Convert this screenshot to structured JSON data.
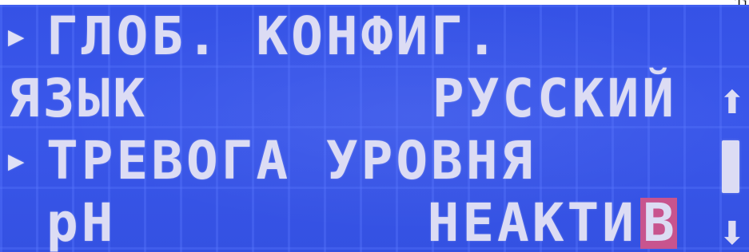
{
  "corner_text": "Ti",
  "screen": {
    "menu_title": "ГЛОБ. КОНФИГ.",
    "selection_pointer": "▶",
    "rows": [
      {
        "label": "ЯЗЫК",
        "value": "РУССКИЙ"
      },
      {
        "label": "ТРЕВОГА УРОВНЯ",
        "value": ""
      },
      {
        "label": "pH",
        "value": "НЕАКТИ",
        "cursor_char": "В"
      }
    ]
  },
  "scrollbar": {
    "up_icon": "up-arrow-icon",
    "down_icon": "down-arrow-icon",
    "up_glyph": "⬆",
    "down_glyph": "⬇"
  },
  "colors": {
    "lcd_background": "#3a57ea",
    "lcd_text": "#dcdcf4",
    "cursor_highlight": "#c8548e"
  }
}
